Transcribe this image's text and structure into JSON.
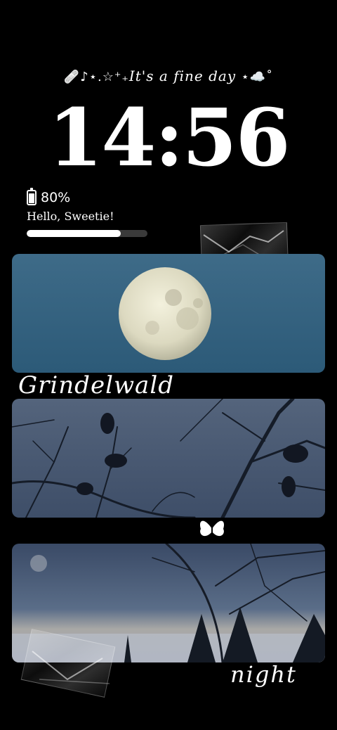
{
  "lockscreen": {
    "tagline_prefix": "🩹♪⋆.☆⁺₊",
    "tagline_text": "It's a fine day",
    "tagline_suffix": "⋆☁️˚",
    "time": "14:56"
  },
  "battery_widget": {
    "percent_label": "80%",
    "level": 0.8,
    "greeting": "Hello, Sweetie!",
    "progress": 0.78
  },
  "photos": [
    {
      "name": "moon-photo",
      "caption": "Grindelwald"
    },
    {
      "name": "birds-branches-photo",
      "caption": ""
    },
    {
      "name": "night-landscape-photo",
      "caption": "night"
    }
  ],
  "icons": {
    "battery": "battery-icon",
    "butterfly": "butterfly-icon"
  },
  "colors": {
    "background": "#000000",
    "sky_blue": "#3d6a87",
    "dusk_blue": "#4a5a73",
    "text": "#ffffff"
  }
}
